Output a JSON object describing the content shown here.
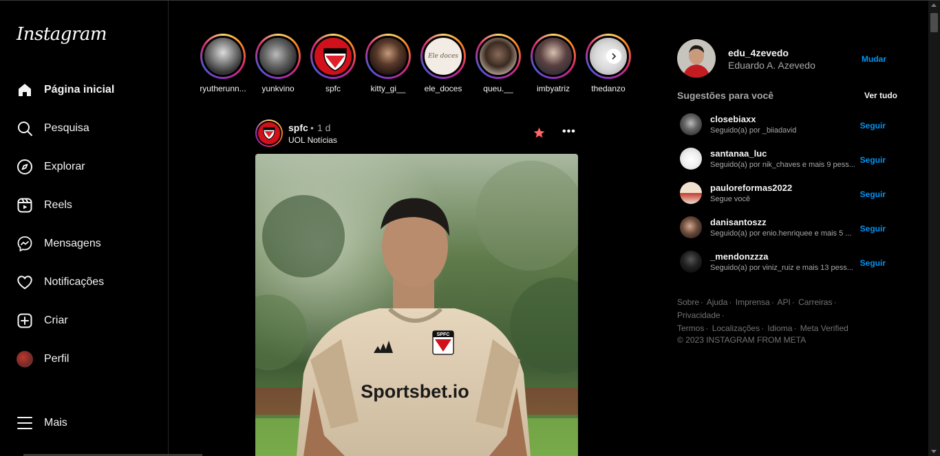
{
  "app": {
    "logo": "Instagram"
  },
  "sidebar": {
    "items": [
      {
        "label": "Página inicial",
        "icon": "home-icon"
      },
      {
        "label": "Pesquisa",
        "icon": "search-icon"
      },
      {
        "label": "Explorar",
        "icon": "compass-icon"
      },
      {
        "label": "Reels",
        "icon": "reels-icon"
      },
      {
        "label": "Mensagens",
        "icon": "messenger-icon"
      },
      {
        "label": "Notificações",
        "icon": "heart-icon"
      },
      {
        "label": "Criar",
        "icon": "plus-square-icon"
      },
      {
        "label": "Perfil",
        "icon": "avatar"
      }
    ],
    "more_label": "Mais"
  },
  "stories": [
    {
      "name": "ryutherunn..."
    },
    {
      "name": "yunkvino"
    },
    {
      "name": "spfc"
    },
    {
      "name": "kitty_gi__"
    },
    {
      "name": "ele_doces"
    },
    {
      "name": "queu.__"
    },
    {
      "name": "imbyatriz"
    },
    {
      "name": "thedanzo"
    }
  ],
  "post": {
    "user": "spfc",
    "dot": "•",
    "time": "1 d",
    "subtitle": "UOL Notícias",
    "more": "•••",
    "image_texts": {
      "crest": "SPFC",
      "sponsor": "Sportsbet.io"
    }
  },
  "profile": {
    "username": "edu_4zevedo",
    "fullname": "Eduardo A. Azevedo",
    "switch_label": "Mudar"
  },
  "suggestions": {
    "title": "Sugestões para você",
    "see_all": "Ver tudo",
    "follow_label": "Seguir",
    "items": [
      {
        "user": "closebiaxx",
        "sub": "Seguido(a) por _biiadavid"
      },
      {
        "user": "santanaa_luc",
        "sub": "Seguido(a) por nik_chaves e mais 9 pess..."
      },
      {
        "user": "pauloreformas2022",
        "sub": "Segue você"
      },
      {
        "user": "danisantoszz",
        "sub": "Seguido(a) por enio.henriquee e mais 5 ..."
      },
      {
        "user": "_mendonzzza",
        "sub": "Seguido(a) por viniz_ruiz e mais 13 pess..."
      }
    ]
  },
  "footer": {
    "links": [
      "Sobre",
      "Ajuda",
      "Imprensa",
      "API",
      "Carreiras",
      "Privacidade",
      "Termos",
      "Localizações",
      "Idioma",
      "Meta Verified"
    ],
    "separator": "·",
    "copyright": "© 2023 INSTAGRAM FROM META"
  },
  "colors": {
    "accent": "#0095f6",
    "background": "#000000",
    "muted": "#a8a8a8",
    "star": "#ff3040"
  }
}
